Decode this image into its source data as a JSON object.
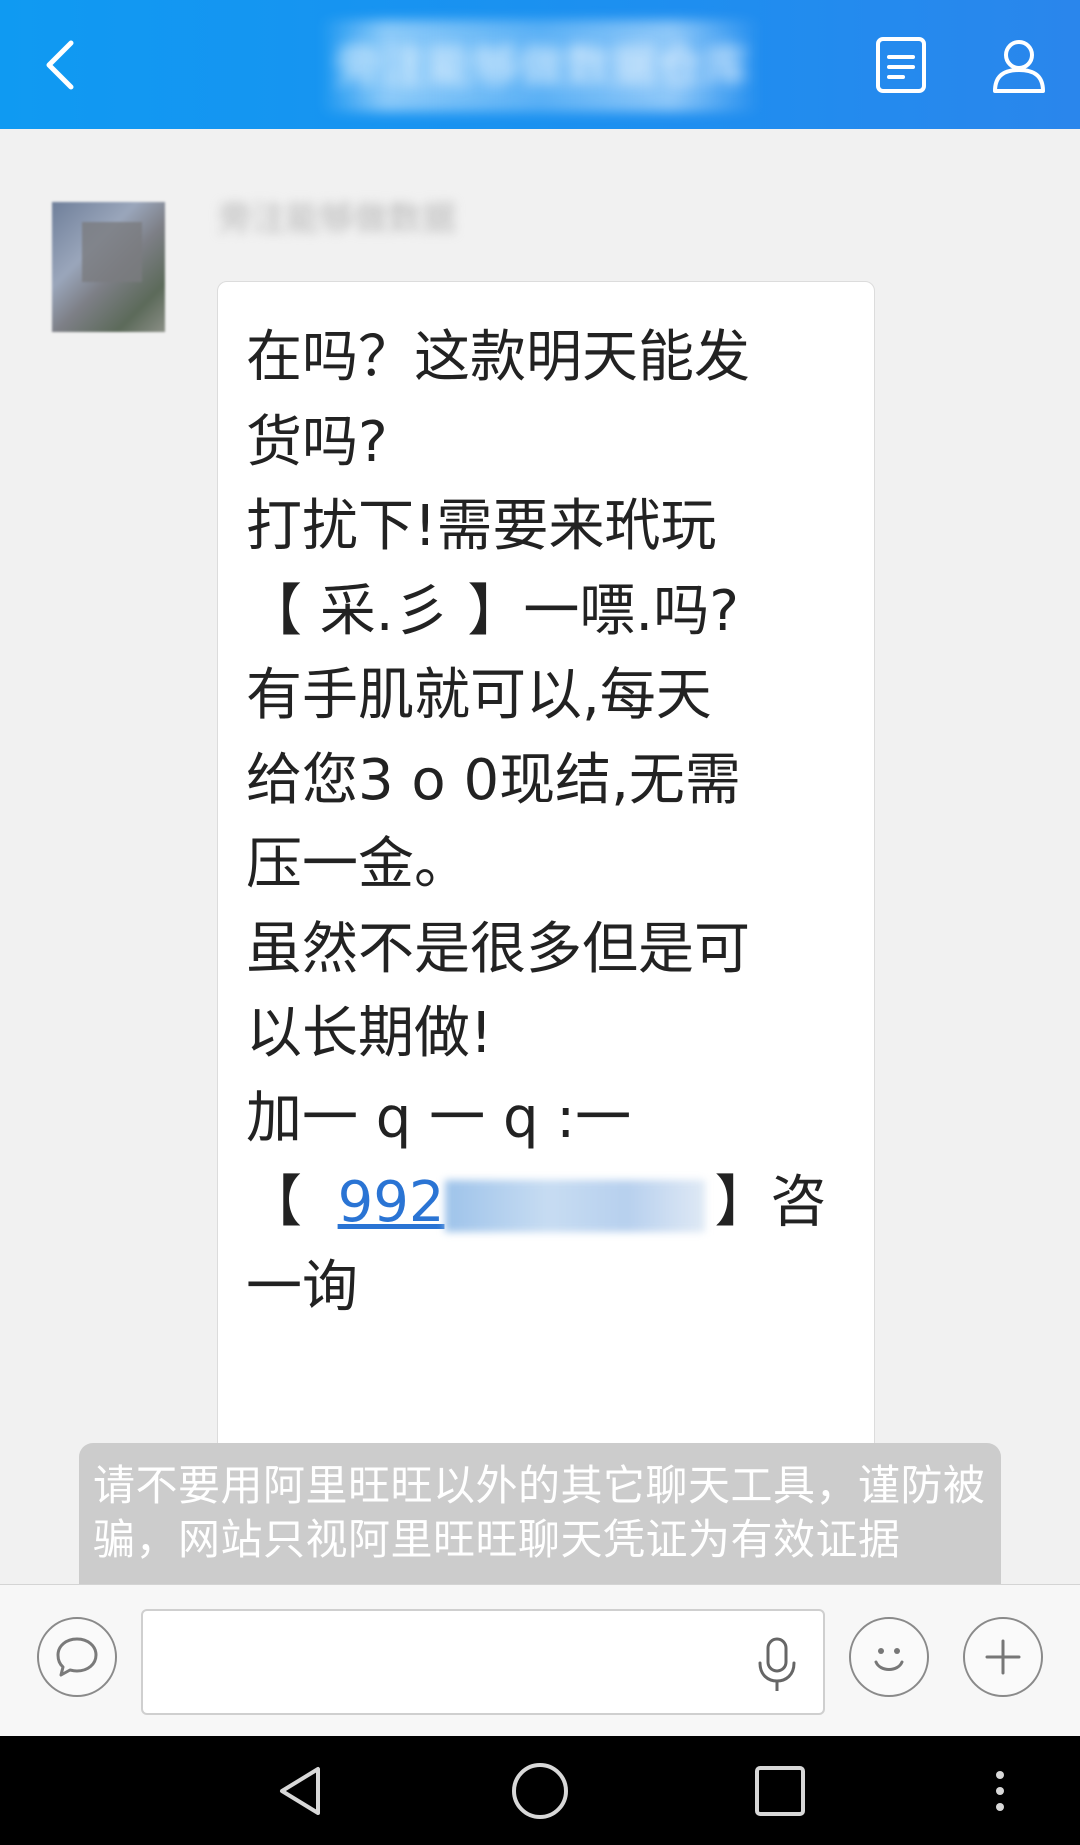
{
  "header": {
    "title": "旁注能够做数据仓库",
    "colors": {
      "bg": "#1d8ff0",
      "fg": "#ffffff"
    },
    "icons": {
      "back": "chevron-left-icon",
      "doc": "document-icon",
      "user": "user-icon"
    }
  },
  "message": {
    "sender": "旁注能够做数据",
    "lines": [
      "在吗？这款明天能发",
      "货吗?",
      "打扰下!需要来玳玩",
      "【 采.彡 】一嘌.吗?",
      "有手肌就可以,每天",
      "给您3 o 0现结,无需",
      "压一金。",
      "虽然不是很多但是可",
      "以长期做!",
      "加一 q 一 q :一"
    ],
    "contact_open": "【",
    "contact_number": "992",
    "contact_close": "】咨",
    "last_line": "一询"
  },
  "notice": {
    "text": "请不要用阿里旺旺以外的其它聊天工具，谨防被骗，网站只视阿里旺旺聊天凭证为有效证据"
  },
  "input": {
    "value": "",
    "icons": {
      "left": "chat-bubble-icon",
      "mic": "microphone-icon",
      "emoji": "smiley-icon",
      "plus": "plus-icon"
    }
  },
  "navbar": {
    "icons": [
      "triangle-back-icon",
      "circle-home-icon",
      "square-recent-icon",
      "more-dots-icon"
    ]
  }
}
